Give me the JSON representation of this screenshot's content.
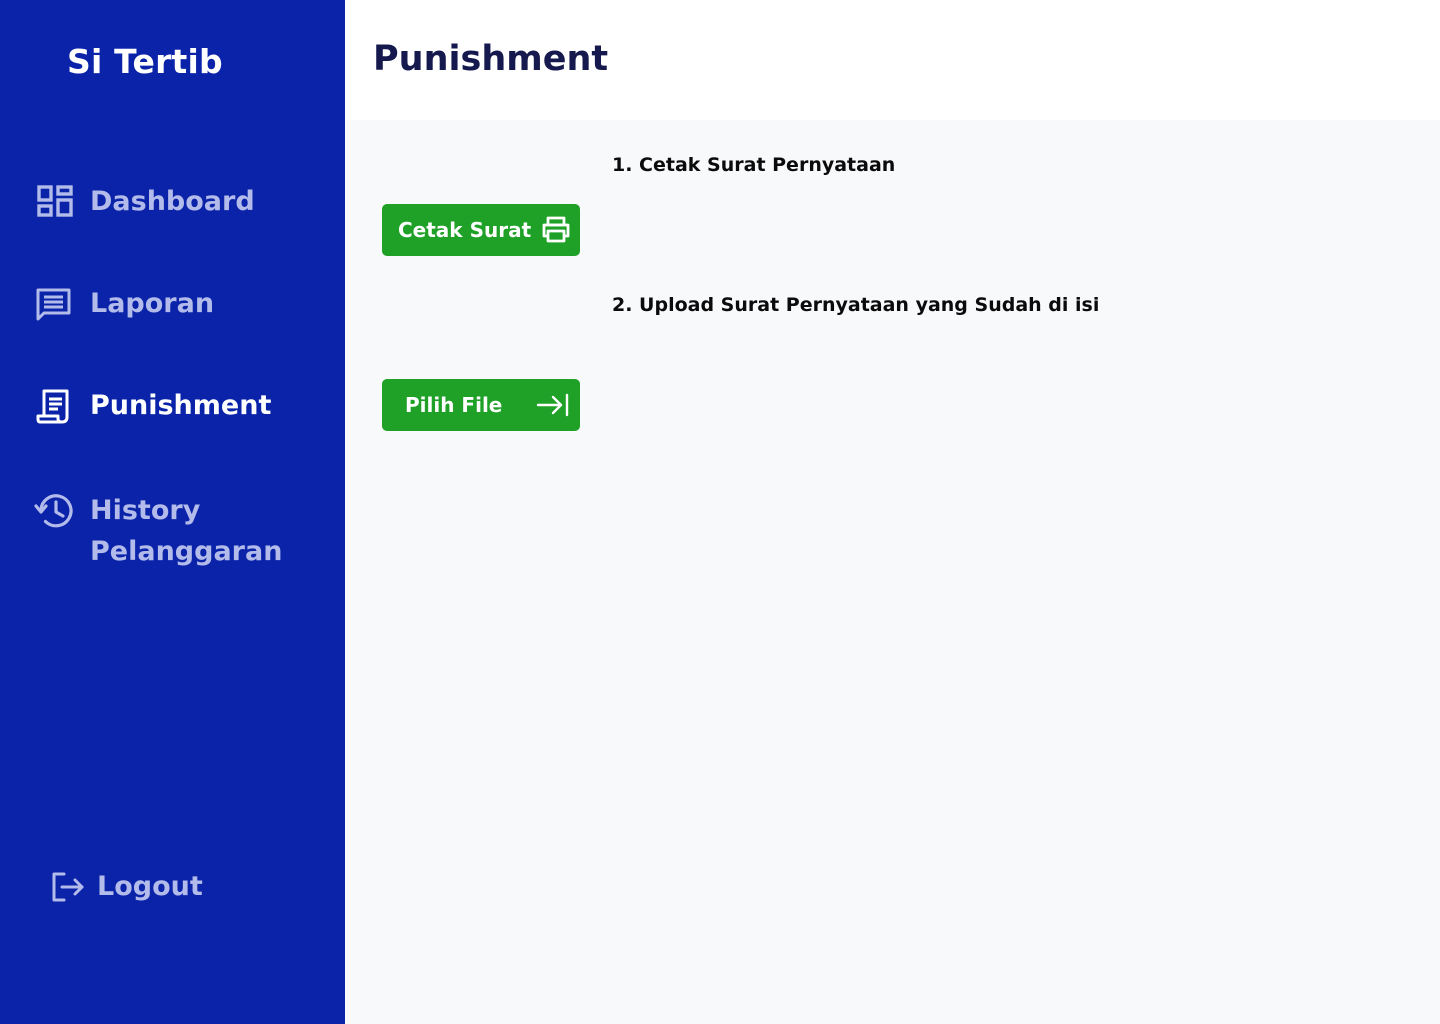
{
  "app": {
    "title": "Si Tertib"
  },
  "sidebar": {
    "items": [
      {
        "label": "Dashboard",
        "icon": "dashboard-icon",
        "active": false
      },
      {
        "label": "Laporan",
        "icon": "message-icon",
        "active": false
      },
      {
        "label": "Punishment",
        "icon": "document-icon",
        "active": true
      },
      {
        "label_line1": "History",
        "label_line2": "Pelanggaran",
        "icon": "history-icon",
        "active": false
      }
    ],
    "logout": {
      "label": "Logout",
      "icon": "logout-icon"
    }
  },
  "header": {
    "title": "Punishment"
  },
  "main": {
    "step1": "1. Cetak Surat Pernyataan",
    "step2": "2. Upload Surat Pernyataan yang Sudah di isi",
    "print_button": {
      "label": "Cetak Surat",
      "icon": "printer-icon"
    },
    "file_button": {
      "label": "Pilih File",
      "icon": "arrow-to-right-icon"
    }
  },
  "colors": {
    "sidebar_bg": "#0a23a9",
    "nav_inactive": "#b3bbea",
    "nav_active": "#ffffff",
    "title_text": "#15194d",
    "button_green": "#1fa128",
    "content_bg": "#f8f9fb"
  }
}
